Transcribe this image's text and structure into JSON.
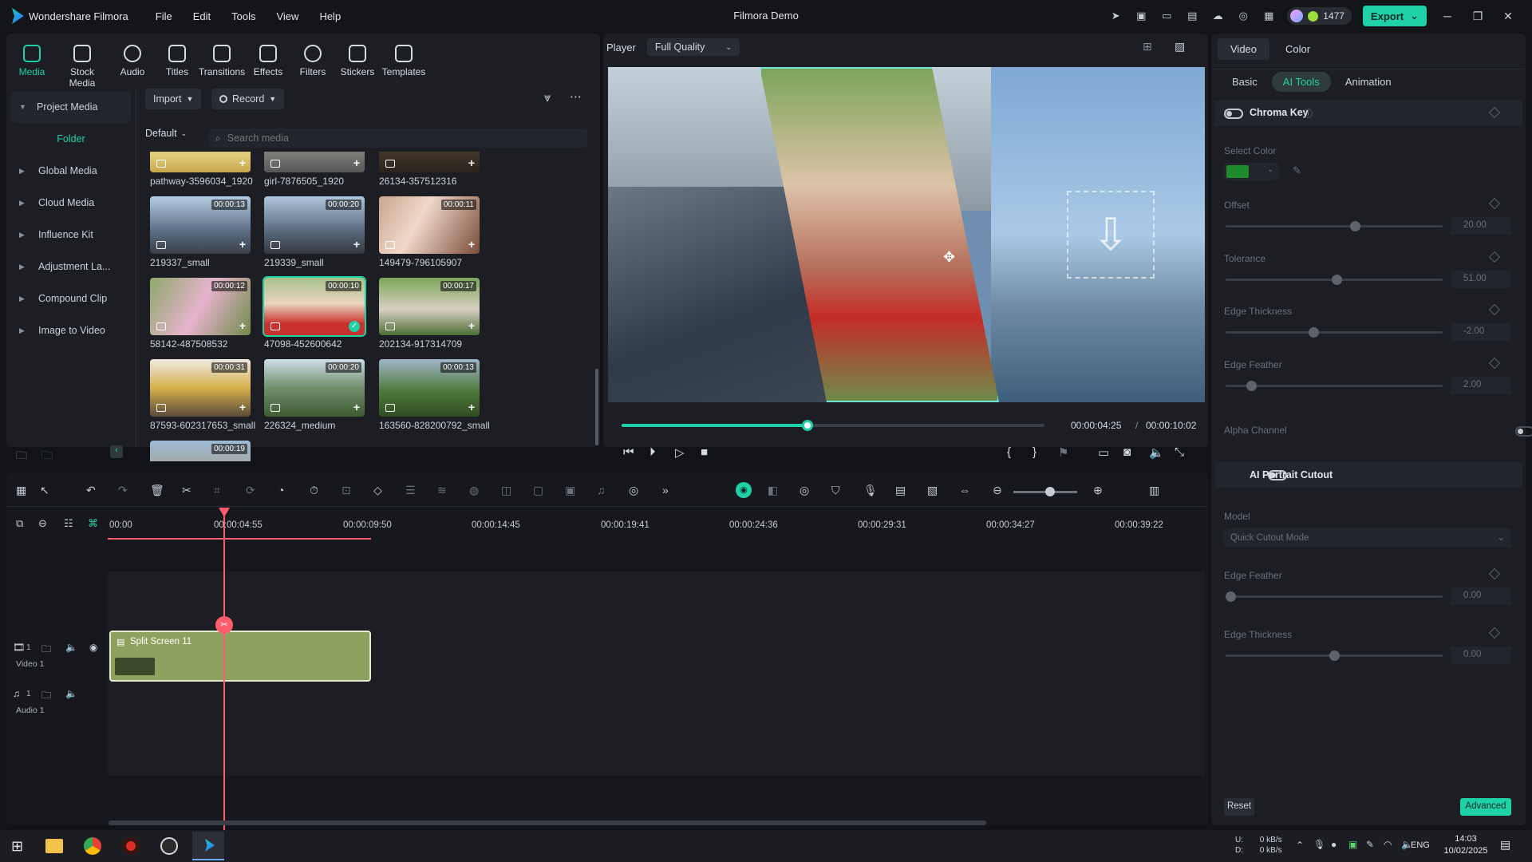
{
  "app": {
    "name": "Wondershare Filmora",
    "window_title": "Filmora Demo",
    "credits": "1477",
    "export_label": "Export"
  },
  "menu": [
    "File",
    "Edit",
    "Tools",
    "View",
    "Help"
  ],
  "media_tabs": [
    "Media",
    "Stock Media",
    "Audio",
    "Titles",
    "Transitions",
    "Effects",
    "Filters",
    "Stickers",
    "Templates"
  ],
  "sidebar": {
    "project_media": "Project Media",
    "folder": "Folder",
    "items": [
      "Global Media",
      "Cloud Media",
      "Influence Kit",
      "Adjustment La...",
      "Compound Clip",
      "Image to Video"
    ]
  },
  "media_toolbar": {
    "import": "Import",
    "record": "Record",
    "sort": "Default",
    "search_placeholder": "Search media"
  },
  "media_items": [
    {
      "name": "pathway-3596034_1920",
      "duration": ""
    },
    {
      "name": "girl-7876505_1920",
      "duration": ""
    },
    {
      "name": "26134-357512316",
      "duration": ""
    },
    {
      "name": "219337_small",
      "duration": "00:00:13"
    },
    {
      "name": "219339_small",
      "duration": "00:00:20"
    },
    {
      "name": "149479-796105907",
      "duration": "00:00:11"
    },
    {
      "name": "58142-487508532",
      "duration": "00:00:12"
    },
    {
      "name": "47098-452600642",
      "duration": "00:00:10"
    },
    {
      "name": "202134-917314709",
      "duration": "00:00:17"
    },
    {
      "name": "87593-602317653_small",
      "duration": "00:00:31"
    },
    {
      "name": "226324_medium",
      "duration": "00:00:20"
    },
    {
      "name": "163560-828200792_small",
      "duration": "00:00:13"
    },
    {
      "name": "",
      "duration": "00:00:19"
    }
  ],
  "player": {
    "label": "Player",
    "quality": "Full Quality",
    "current_time": "00:00:04:25",
    "separator": "/",
    "total_time": "00:00:10:02",
    "progress": 0.44
  },
  "right_panel": {
    "tabs": [
      "Video",
      "Color"
    ],
    "subtabs": [
      "Basic",
      "AI Tools",
      "Animation"
    ],
    "chroma_key": "Chroma Key",
    "select_color": "Select Color",
    "chroma_color": "#1e8a2c",
    "params": [
      {
        "label": "Offset",
        "value": "20.00",
        "pos": 0.6
      },
      {
        "label": "Tolerance",
        "value": "51.00",
        "pos": 0.51
      },
      {
        "label": "Edge Thickness",
        "value": "-2.00",
        "pos": 0.4
      },
      {
        "label": "Edge Feather",
        "value": "2.00",
        "pos": 0.1
      }
    ],
    "alpha_channel": "Alpha Channel",
    "ai_portrait": "AI Portrait Cutout",
    "model_label": "Model",
    "model_value": "Quick Cutout Mode",
    "ai_params": [
      {
        "label": "Edge Feather",
        "value": "0.00",
        "pos": 0.0
      },
      {
        "label": "Edge Thickness",
        "value": "0.00",
        "pos": 0.5
      }
    ],
    "reset": "Reset",
    "advanced": "Advanced"
  },
  "timeline": {
    "ruler": [
      "00:00",
      "00:00:04:55",
      "00:00:09:50",
      "00:00:14:45",
      "00:00:19:41",
      "00:00:24:36",
      "00:00:29:31",
      "00:00:34:27",
      "00:00:39:22"
    ],
    "clip_name": "Split Screen 11",
    "video_track": "Video 1",
    "audio_track": "Audio 1",
    "video_track_num": "1",
    "audio_track_num": "1"
  },
  "taskbar": {
    "net_up": "0 kB/s",
    "net_down": "0 kB/s",
    "net_u": "U:",
    "net_d": "D:",
    "lang": "ENG",
    "time": "14:03",
    "date": "10/02/2025"
  },
  "colors": {
    "accent": "#1fd1a6",
    "playhead": "#ff5c6c",
    "clip": "#8fa15e"
  }
}
